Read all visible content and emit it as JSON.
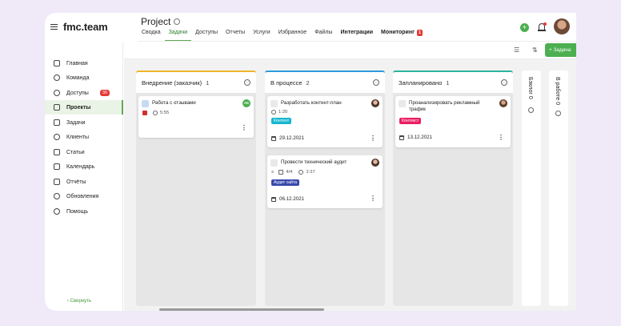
{
  "app": {
    "logo": "fmc.team"
  },
  "header": {
    "title": "Project",
    "tabs": [
      {
        "label": "Сводка"
      },
      {
        "label": "Задачи"
      },
      {
        "label": "Доступы"
      },
      {
        "label": "Отчеты"
      },
      {
        "label": "Услуги"
      },
      {
        "label": "Избранное"
      },
      {
        "label": "Файлы"
      },
      {
        "label": "Интеграции"
      },
      {
        "label": "Мониторинг",
        "count": "1"
      }
    ],
    "active_tab": "Задачи"
  },
  "sidebar": {
    "items": [
      {
        "label": "Главная",
        "icon": "home-icon"
      },
      {
        "label": "Команда",
        "icon": "team-icon"
      },
      {
        "label": "Доступы",
        "icon": "key-icon",
        "badge": "30"
      },
      {
        "label": "Проекты",
        "icon": "projects-icon"
      },
      {
        "label": "Задачи",
        "icon": "tasks-icon"
      },
      {
        "label": "Клиенты",
        "icon": "clients-icon"
      },
      {
        "label": "Статьи",
        "icon": "articles-icon"
      },
      {
        "label": "Календарь",
        "icon": "calendar-icon"
      },
      {
        "label": "Отчёты",
        "icon": "reports-icon"
      },
      {
        "label": "Обновления",
        "icon": "updates-icon"
      },
      {
        "label": "Помощь",
        "icon": "help-icon"
      }
    ],
    "active_item": "Проекты",
    "collapse_label": "Свернуть"
  },
  "toolbar": {
    "add_task_label": "+ Задача"
  },
  "board": {
    "columns": [
      {
        "title": "Внедрение (заказчик)",
        "count": "1",
        "accent": "#f0b429",
        "cards": [
          {
            "title": "Работа с отзывами",
            "assignee": "АК",
            "time": "5:55",
            "blocked": true
          }
        ]
      },
      {
        "title": "В процессе",
        "count": "2",
        "accent": "#2a9bd8",
        "cards": [
          {
            "title": "Разработать контент-план",
            "time": "1:20",
            "tag": "Контент",
            "date": "29.12.2021"
          },
          {
            "title": "Провести технический аудит",
            "checklist": "4/4",
            "time": "2:37",
            "tag": "Аудит сайта",
            "date": "06.12.2021"
          }
        ]
      },
      {
        "title": "Запланировано",
        "count": "1",
        "accent": "#2bb39a",
        "cards": [
          {
            "title": "Проанализировать рекламный трафик",
            "tag": "Контекст",
            "date": "13.12.2021"
          }
        ]
      }
    ],
    "collapsed_columns": [
      {
        "title": "Бэклог",
        "count": "0"
      },
      {
        "title": "В работе",
        "count": "0"
      }
    ]
  },
  "colors": {
    "accent_green": "#4caf50",
    "alert_red": "#e53935",
    "tag_cyan": "#17b7d0",
    "tag_pink": "#e91e63",
    "tag_navy": "#3949ab"
  }
}
